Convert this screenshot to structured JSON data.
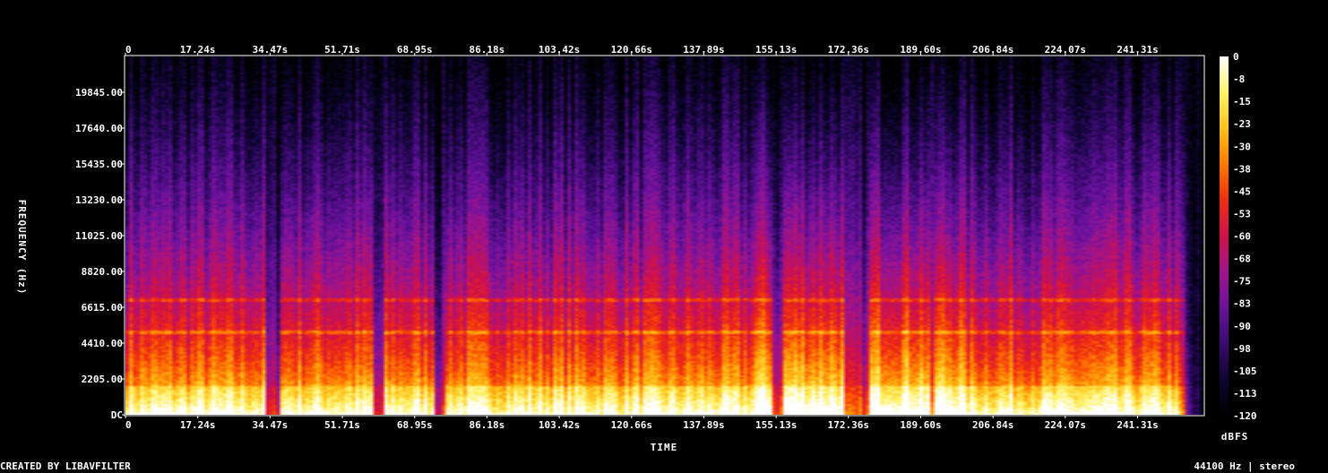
{
  "chart_data": {
    "type": "heatmap",
    "title": "",
    "xlabel": "TIME",
    "ylabel": "FREQUENCY (Hz)",
    "x_ticks": [
      "0",
      "17.24s",
      "34.47s",
      "51.71s",
      "68.95s",
      "86.18s",
      "103.42s",
      "120.66s",
      "137.89s",
      "155.13s",
      "172.36s",
      "189.60s",
      "206.84s",
      "224.07s",
      "241.31s"
    ],
    "x_tick_values": [
      0,
      17.24,
      34.47,
      51.71,
      68.95,
      86.18,
      103.42,
      120.66,
      137.89,
      155.13,
      172.36,
      189.6,
      206.84,
      224.07,
      241.31
    ],
    "xlim": [
      0,
      257
    ],
    "y_ticks": [
      "DC",
      "2205.00",
      "4410.00",
      "6615.00",
      "8820.00",
      "11025.00",
      "13230.00",
      "15435.00",
      "17640.00",
      "19845.00"
    ],
    "y_tick_values": [
      0,
      2205,
      4410,
      6615,
      8820,
      11025,
      13230,
      15435,
      17640,
      19845
    ],
    "ylim": [
      0,
      22050
    ],
    "colorbar": {
      "unit": "dBFS",
      "ticks": [
        "0",
        "-8",
        "-15",
        "-23",
        "-30",
        "-38",
        "-45",
        "-53",
        "-60",
        "-68",
        "-75",
        "-83",
        "-90",
        "-98",
        "-105",
        "-113",
        "-120"
      ],
      "range": [
        -120,
        0
      ],
      "colors": [
        "#000000",
        "#0d0530",
        "#3a0a6e",
        "#6a12a0",
        "#a0148a",
        "#d0104a",
        "#f02c10",
        "#ff7a00",
        "#ffc21a",
        "#fff36a",
        "#ffffff"
      ]
    },
    "quiet_intervals_s": [
      [
        33,
        37
      ],
      [
        59,
        62
      ],
      [
        74,
        76
      ],
      [
        154,
        157
      ],
      [
        171,
        177
      ],
      [
        192,
        193
      ],
      [
        253,
        257
      ]
    ],
    "harmonic_bands_hz": [
      5100,
      7100
    ]
  },
  "footer": {
    "left": "CREATED BY LIBAVFILTER",
    "right": "44100 Hz | stereo"
  }
}
